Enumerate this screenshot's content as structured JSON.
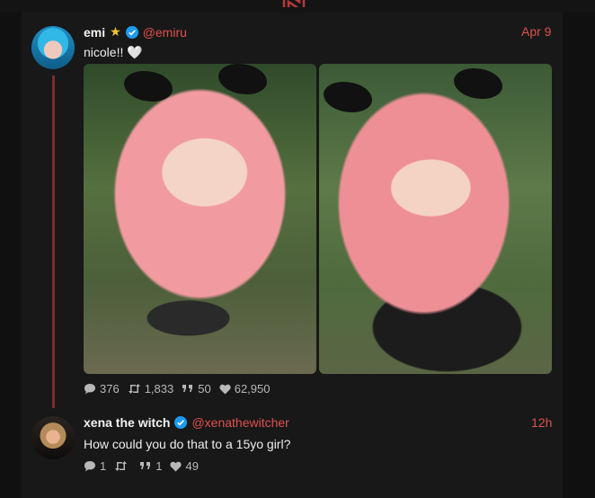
{
  "colors": {
    "accent": "#e04f4f",
    "verified": "#1d9bf0",
    "star": "#f2c230"
  },
  "post": {
    "author": {
      "name": "emi",
      "handle": "@emiru",
      "badges": [
        "star-icon",
        "verified-icon"
      ]
    },
    "time": "Apr 9",
    "text": "nicole!! 🤍",
    "media_count": 2,
    "stats": {
      "replies": "376",
      "reposts": "1,833",
      "quotes": "50",
      "likes": "62,950"
    }
  },
  "reply": {
    "author": {
      "name": "xena the witch",
      "handle": "@xenathewitcher",
      "badges": [
        "verified-icon"
      ]
    },
    "time": "12h",
    "text": "How could you do that to a 15yo girl?",
    "stats": {
      "replies": "1",
      "reposts": "",
      "quotes": "1",
      "likes": "49"
    }
  }
}
